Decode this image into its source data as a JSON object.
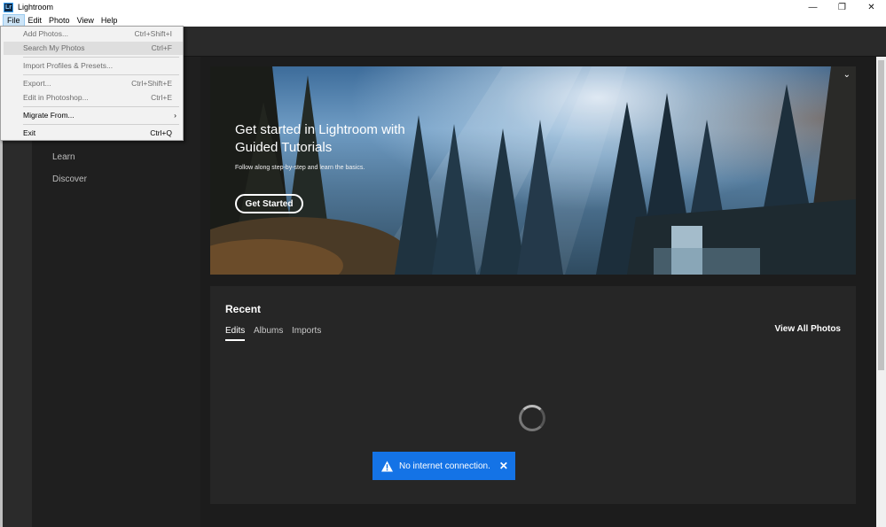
{
  "window": {
    "title": "Lightroom",
    "icon_text": "Lr",
    "controls": {
      "minimize": "—",
      "restore": "❐",
      "close": "✕"
    }
  },
  "menubar": {
    "items": [
      "File",
      "Edit",
      "Photo",
      "View",
      "Help"
    ]
  },
  "file_menu": {
    "items": [
      {
        "label": "Add Photos...",
        "shortcut": "Ctrl+Shift+I"
      },
      {
        "label": "Search My Photos",
        "shortcut": "Ctrl+F"
      },
      {
        "label": "Import Profiles & Presets...",
        "shortcut": ""
      },
      {
        "label": "Export...",
        "shortcut": "Ctrl+Shift+E"
      },
      {
        "label": "Edit in Photoshop...",
        "shortcut": "Ctrl+E"
      },
      {
        "label": "Migrate From...",
        "shortcut": "›"
      },
      {
        "label": "Exit",
        "shortcut": "Ctrl+Q"
      }
    ]
  },
  "sidebar": {
    "items": [
      "Learn",
      "Discover"
    ]
  },
  "hero": {
    "title": "Get started in Lightroom with Guided Tutorials",
    "subtitle": "Follow along step-by-step and learn the basics.",
    "button": "Get Started",
    "collapse_icon": "⌄"
  },
  "recent": {
    "title": "Recent",
    "tabs": [
      "Edits",
      "Albums",
      "Imports"
    ],
    "view_all": "View All Photos"
  },
  "toast": {
    "message": "No internet connection.",
    "close": "✕",
    "color": "#1473e6"
  }
}
